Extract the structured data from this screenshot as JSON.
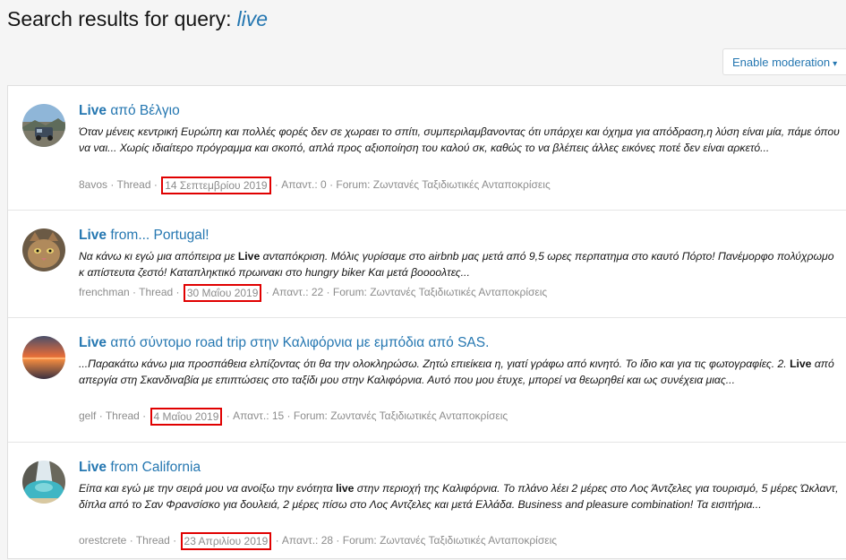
{
  "header": {
    "title_prefix": "Search results for query:",
    "query": "live"
  },
  "toolbar": {
    "moderation_label": "Enable moderation",
    "caret": "▾"
  },
  "results": [
    {
      "title_bold": "Live",
      "title_rest": " από Βέλγιο",
      "snippet_parts": [
        {
          "text": "Όταν μένεις κεντρική Ευρώπη και πολλές φορές δεν σε χωραει το σπίτι, συμπεριλαμβανοντας ότι υπάρχει και όχημα για απόδραση,η λύση είναι μία, πάμε όπου να ναι... Χωρίς ιδιαίτερο πρόγραμμα και σκοπό, απλά προς αξιοποίηση του καλού σκ, καθώς το να βλέπεις άλλες εικόνες ποτέ δεν είναι αρκετό...",
          "bold": false
        }
      ],
      "author": "8avos",
      "type": "Thread",
      "date": "14 Σεπτεμβρίου 2019",
      "replies": "Απαντ.: 0",
      "forum": "Forum: Ζωντανές Ταξιδιωτικές Ανταποκρίσεις",
      "avatar": "van-landscape-icon"
    },
    {
      "title_bold": "Live",
      "title_rest": " from... Portugal!",
      "snippet_parts": [
        {
          "text": "Να κάνω κι εγώ μια απόπειρα με ",
          "bold": false
        },
        {
          "text": "Live",
          "bold": true
        },
        {
          "text": " ανταπόκριση. Μόλις γυρίσαμε στο airbnb μας μετά από 9,5 ωρες περπατημα στο καυτό Πόρτο! Πανέμορφο πολύχρωμο κ απίστευτα ζεστό! Καταπληκτικό πρωινακι στο hungry biker Και μετά βοοοολτες...",
          "bold": false
        }
      ],
      "author": "frenchman",
      "type": "Thread",
      "date": "30 Μαΐου 2019",
      "replies": "Απαντ.: 22",
      "forum": "Forum: Ζωντανές Ταξιδιωτικές Ανταποκρίσεις",
      "avatar": "cat-icon"
    },
    {
      "title_bold": "Live",
      "title_rest": " από σύντομο road trip στην Καλιφόρνια με εμπόδια από SAS.",
      "snippet_parts": [
        {
          "text": "...Παρακάτω κάνω μια προσπάθεια ελπίζοντας ότι θα την ολοκληρώσω. Ζητώ επιείκεια η, γιατί γράφω από κινητό. Το ίδιο και για τις φωτογραφίες. 2. ",
          "bold": false
        },
        {
          "text": "Live",
          "bold": true
        },
        {
          "text": " από απεργία στη Σκανδιναβία με επιπτώσεις στο ταξίδι μου στην Καλιφόρνια. Αυτό που μου έτυχε, μπορεί να θεωρηθεί και ως συνέχεια μιας...",
          "bold": false
        }
      ],
      "author": "gelf",
      "type": "Thread",
      "date": "4 Μαΐου 2019",
      "replies": "Απαντ.: 15",
      "forum": "Forum: Ζωντανές Ταξιδιωτικές Ανταποκρίσεις",
      "avatar": "sunset-icon"
    },
    {
      "title_bold": "Live",
      "title_rest": " from California",
      "snippet_parts": [
        {
          "text": "Είπα και εγώ με την σειρά μου να ανοίξω την ενότητα ",
          "bold": false
        },
        {
          "text": "live",
          "bold": true
        },
        {
          "text": " στην περιοχή της Καλιφόρνια. Το πλάνο λέει 2 μέρες στο Λος Άντζελες για τουρισμό, 5 μέρες Ώκλαντ, δίπλα από το Σαν Φρανσίσκο για δουλειά, 2 μέρες πίσω στο Λος Αντζελες και μετά Ελλάδα. Business and pleasure combination! Τα εισιτήρια...",
          "bold": false
        }
      ],
      "author": "orestcrete",
      "type": "Thread",
      "date": "23 Απριλίου 2019",
      "replies": "Απαντ.: 28",
      "forum": "Forum: Ζωντανές Ταξιδιωτικές Ανταποκρίσεις",
      "avatar": "beach-cove-icon"
    }
  ]
}
